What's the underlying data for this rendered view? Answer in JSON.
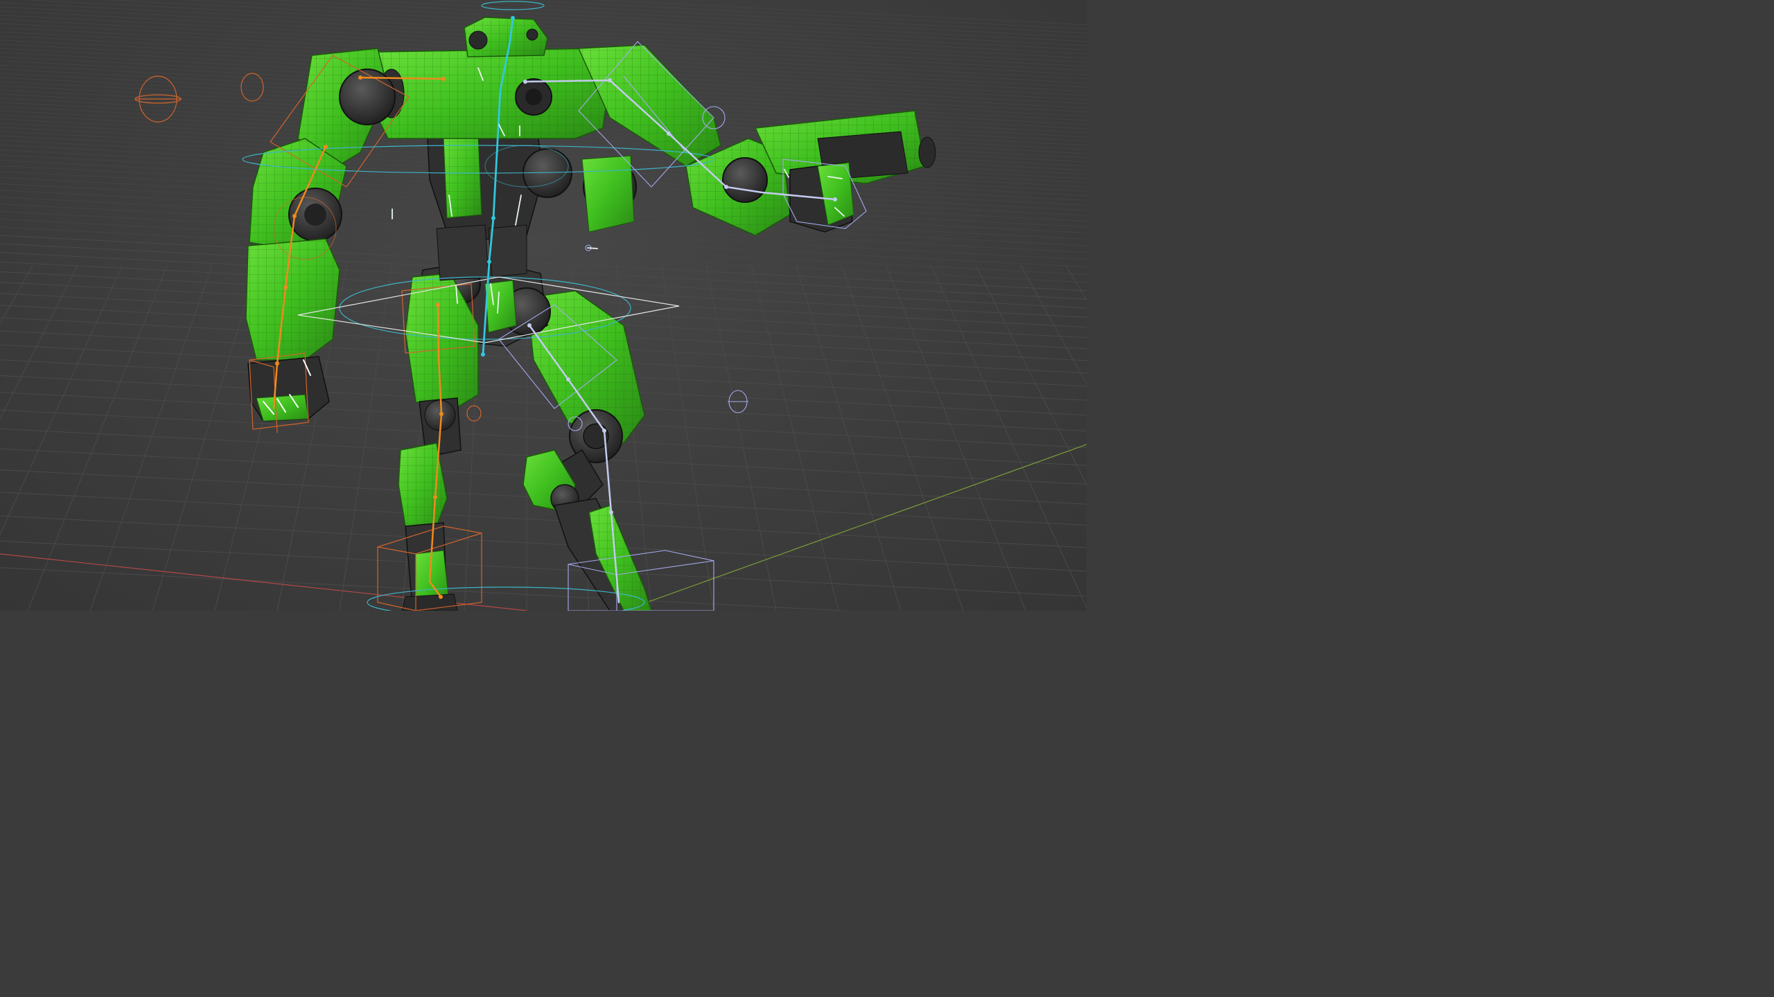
{
  "viewport": {
    "kind": "3d-viewport",
    "subject": "rigged-robot-model",
    "shading": "wireframe-overlay",
    "show_grid": true,
    "show_axes": true
  },
  "colors": {
    "background": "#3d3d3d",
    "grid_line": "#4a4a4a",
    "mesh_fill": "#3fbf1f",
    "mesh_light": "#5fdc35",
    "mesh_dark": "#2a8a14",
    "mesh_wire": "#1a5a0a",
    "joint_metal": "#2e2e2e",
    "joint_rim": "#1a1a1a",
    "bone_left": "#f08a1e",
    "bone_center": "#32c8dc",
    "bone_right": "#c4cbf0",
    "control_left": "#d2642a",
    "control_center": "#3cb4c8",
    "control_right": "#a6aaf0",
    "control_root": "#e6e6e6",
    "axis_x": "#b44848",
    "axis_y": "#7a9a3a"
  },
  "icons": {
    "left_ik_pole_ring": "orbit-gizmo-icon",
    "right_ik_pole_ring": "orbit-gizmo-icon"
  }
}
